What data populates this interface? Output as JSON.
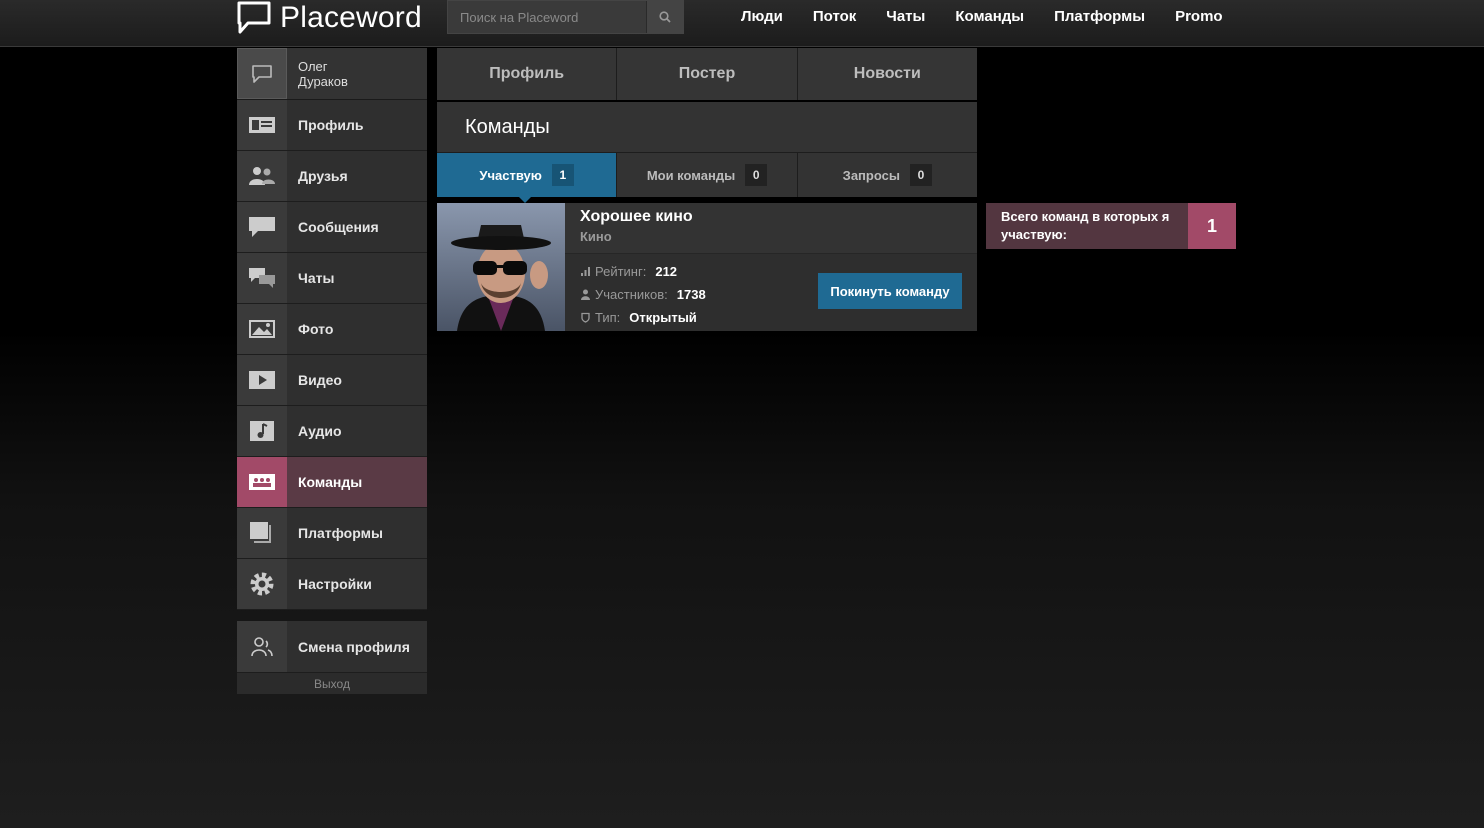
{
  "app": {
    "logo_text": "Placeword"
  },
  "search": {
    "placeholder": "Поиск на Placeword",
    "value": ""
  },
  "nav": [
    "Люди",
    "Поток",
    "Чаты",
    "Команды",
    "Платформы",
    "Promo"
  ],
  "user": {
    "first_name": "Олег",
    "last_name": "Дураков"
  },
  "sidebar": {
    "items": [
      {
        "label": "Профиль",
        "icon": "profile-card-icon"
      },
      {
        "label": "Друзья",
        "icon": "friends-icon"
      },
      {
        "label": "Сообщения",
        "icon": "message-icon"
      },
      {
        "label": "Чаты",
        "icon": "chat-icon"
      },
      {
        "label": "Фото",
        "icon": "photo-icon"
      },
      {
        "label": "Видео",
        "icon": "video-icon"
      },
      {
        "label": "Аудио",
        "icon": "audio-icon"
      },
      {
        "label": "Команды",
        "icon": "teams-icon",
        "active": true
      },
      {
        "label": "Платформы",
        "icon": "platforms-icon"
      },
      {
        "label": "Настройки",
        "icon": "settings-gear-icon"
      }
    ],
    "switch_profile": "Смена профиля",
    "exit": "Выход"
  },
  "profile_tabs": [
    "Профиль",
    "Постер",
    "Новости"
  ],
  "section_title": "Команды",
  "sub_tabs": [
    {
      "label": "Участвую",
      "count": "1",
      "active": true
    },
    {
      "label": "Мои команды",
      "count": "0"
    },
    {
      "label": "Запросы",
      "count": "0"
    }
  ],
  "team": {
    "name": "Хорошее кино",
    "category": "Кино",
    "rating_label": "Рейтинг:",
    "rating": "212",
    "members_label": "Участников:",
    "members": "1738",
    "type_label": "Тип:",
    "type": "Открытый",
    "leave_label": "Покинуть команду"
  },
  "info": {
    "text": "Всего команд в которых я участвую:",
    "count": "1"
  },
  "colors": {
    "accent_blue": "#1f6a93",
    "accent_pink": "#a24a68"
  }
}
